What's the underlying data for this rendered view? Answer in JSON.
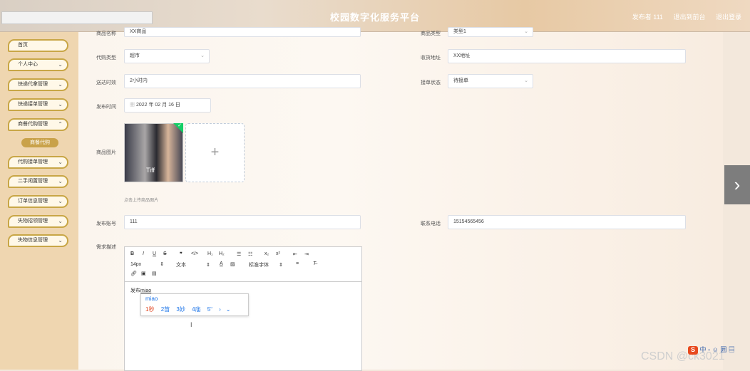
{
  "header": {
    "title": "校园数字化服务平台",
    "user": "发布者 111",
    "back_label": "退出到前台",
    "logout_label": "退出登录"
  },
  "sidebar": {
    "items": [
      {
        "label": "首页"
      },
      {
        "label": "个人中心"
      },
      {
        "label": "快递代拿管理"
      },
      {
        "label": "快递接单管理"
      },
      {
        "label": "商餐代购管理"
      },
      {
        "label": "代购接单管理"
      },
      {
        "label": "二手闲置管理"
      },
      {
        "label": "订单信息管理"
      },
      {
        "label": "失物招领管理"
      },
      {
        "label": "失物信息管理"
      }
    ],
    "submenu": "商餐代购"
  },
  "form": {
    "product_name_label": "商品名称",
    "product_name_value": "XX商品",
    "product_type_label": "商品类型",
    "product_type_value": "类型1",
    "purchase_type_label": "代购类型",
    "purchase_type_value": "超市",
    "delivery_address_label": "收货地址",
    "delivery_address_value": "XX地址",
    "delivery_time_label": "送达时效",
    "delivery_time_value": "2小时内",
    "order_status_label": "接单状态",
    "order_status_value": "待接单",
    "publish_time_label": "发布时间",
    "publish_time_value": "2022 年 02 月 16 日",
    "image_label": "商品图片",
    "image_hint": "点击上传商品图片",
    "image_caption": "Tiff",
    "account_label": "发布账号",
    "account_value": "111",
    "phone_label": "联系电话",
    "phone_value": "15154565456",
    "desc_label": "需求描述"
  },
  "editor": {
    "font_size": "14px",
    "text_type": "文本",
    "font_family": "标准字体",
    "content_prefix": "发布",
    "content_typing": "miao",
    "ime_pinyin": "miao",
    "candidates": [
      "1秒",
      "2苗",
      "3妙",
      "4庙",
      "5“"
    ]
  },
  "watermark": "CSDN @ck3021",
  "sogou_text": "中 ◦ ☺ 囲 ▤"
}
